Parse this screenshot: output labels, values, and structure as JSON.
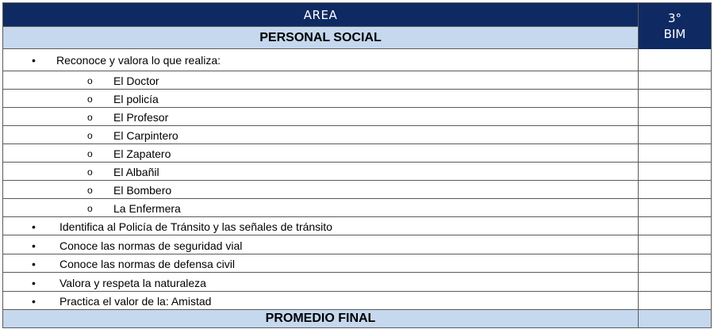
{
  "header": {
    "area_label": "AREA",
    "subject": "PERSONAL SOCIAL",
    "bim_line1": "3°",
    "bim_line2": "BIM"
  },
  "criterion_main": {
    "text": "Reconoce y valora lo que realiza:",
    "bullet": "•"
  },
  "sub_items": [
    {
      "bullet": "o",
      "text": "El Doctor"
    },
    {
      "bullet": "o",
      "text": "El policía"
    },
    {
      "bullet": "o",
      "text": "El Profesor"
    },
    {
      "bullet": "o",
      "text": "El Carpintero"
    },
    {
      "bullet": "o",
      "text": "El Zapatero"
    },
    {
      "bullet": "o",
      "text": "El Albañil"
    },
    {
      "bullet": "o",
      "text": "El Bombero"
    },
    {
      "bullet": "o",
      "text": "La Enfermera"
    }
  ],
  "criteria": [
    {
      "bullet": "•",
      "text": "Identifica al Policía de Tránsito y las señales de tránsito"
    },
    {
      "bullet": "•",
      "text": "Conoce las normas de seguridad vial"
    },
    {
      "bullet": "•",
      "text": "Conoce las normas de defensa civil"
    },
    {
      "bullet": "•",
      "text": "Valora y respeta la naturaleza"
    },
    {
      "bullet": "•",
      "text": "Practica el valor de la: Amistad"
    }
  ],
  "footer": {
    "label": "PROMEDIO FINAL"
  },
  "colors": {
    "header_navy": "#0f2a63",
    "subheader_blue": "#c5d8ee",
    "border": "#5a5a5a"
  }
}
